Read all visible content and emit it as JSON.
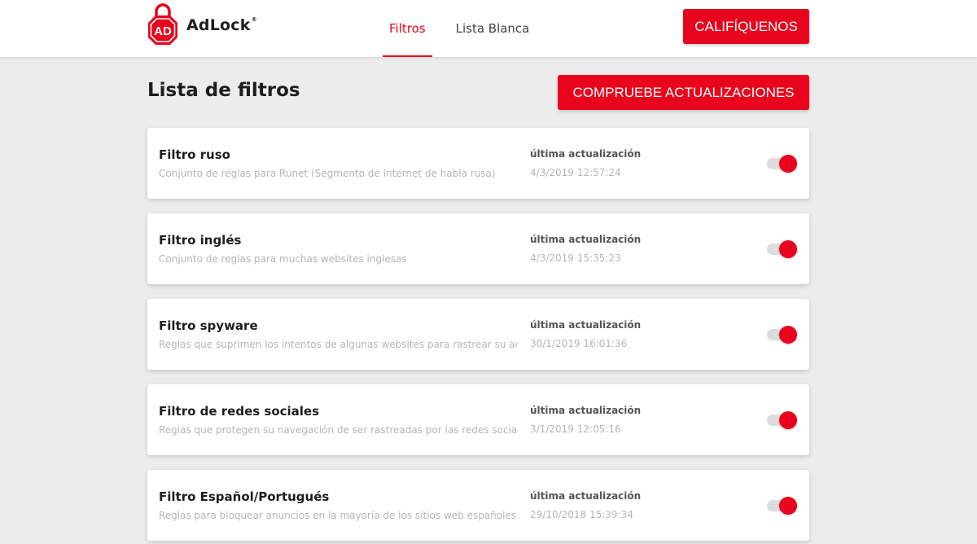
{
  "brand": {
    "name": "AdLock",
    "trademark": "®",
    "accent_color": "#e8041c"
  },
  "nav": {
    "items": [
      {
        "label": "Filtros",
        "active": true
      },
      {
        "label": "Lista Blanca",
        "active": false
      }
    ]
  },
  "header": {
    "rate_button": "CALIFÍQUENOS"
  },
  "page": {
    "title": "Lista de filtros",
    "update_button": "COMPRUEBE ACTUALIZACIONES"
  },
  "filters": [
    {
      "name": "Filtro ruso",
      "description": "Conjunto de reglas para Runet (Segmento de internet de habla rusa)",
      "updated_label": "última actualización",
      "updated_at": "4/3/2019 12:57:24",
      "enabled": true
    },
    {
      "name": "Filtro inglés",
      "description": "Conjunto de reglas para muchas websites inglesas",
      "updated_label": "última actualización",
      "updated_at": "4/3/2019 15:35:23",
      "enabled": true
    },
    {
      "name": "Filtro spyware",
      "description": "Reglas que suprimen los intentos de algunas websites para rastrear su actividad",
      "updated_label": "última actualización",
      "updated_at": "30/1/2019 16:01:36",
      "enabled": true
    },
    {
      "name": "Filtro de redes sociales",
      "description": "Reglas que protegen su navegación de ser rastreadas por las redes sociales",
      "updated_label": "última actualización",
      "updated_at": "3/1/2019 12:05:16",
      "enabled": true
    },
    {
      "name": "Filtro Español/Portugués",
      "description": "Reglas para bloquear anuncios en la mayoría de los sitios web españoles y portugueses",
      "updated_label": "última actualización",
      "updated_at": "29/10/2018 15:39:34",
      "enabled": true
    }
  ]
}
